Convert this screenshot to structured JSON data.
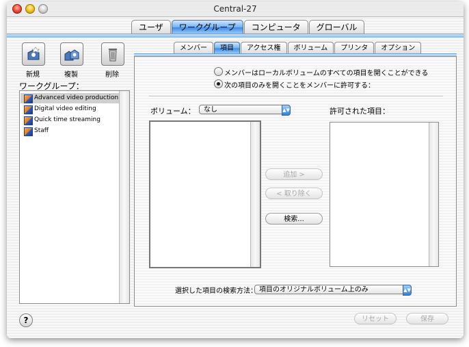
{
  "window": {
    "title": "Central-27"
  },
  "main_tabs": [
    {
      "label": "ユーザ",
      "active": false
    },
    {
      "label": "ワークグループ",
      "active": true
    },
    {
      "label": "コンピュータ",
      "active": false
    },
    {
      "label": "グローバル",
      "active": false
    }
  ],
  "toolbar": {
    "new_label": "新規",
    "duplicate_label": "複製",
    "delete_label": "削除"
  },
  "workgroups": {
    "label": "ワークグループ：",
    "items": [
      {
        "label": "Advanced video production",
        "selected": true
      },
      {
        "label": "Digital video editing",
        "selected": false
      },
      {
        "label": "Quick time streaming",
        "selected": false
      },
      {
        "label": "Staff",
        "selected": false
      }
    ]
  },
  "sub_tabs": [
    {
      "label": "メンバー",
      "active": false
    },
    {
      "label": "項目",
      "active": true
    },
    {
      "label": "アクセス権",
      "active": false
    },
    {
      "label": "ボリューム",
      "active": false
    },
    {
      "label": "プリンタ",
      "active": false
    },
    {
      "label": "オプション",
      "active": false
    }
  ],
  "options": {
    "radio_all": {
      "label": "メンバーはローカルボリュームのすべての項目を開くことができる",
      "checked": false
    },
    "radio_only": {
      "label": "次の項目のみを開くことをメンバーに許可する：",
      "checked": true
    }
  },
  "volume": {
    "label": "ボリューム：",
    "value": "なし"
  },
  "allowed_items": {
    "label": "許可された項目："
  },
  "buttons": {
    "add": "追加 >",
    "remove": "< 取り除く",
    "search": "検索..."
  },
  "search_method": {
    "label": "選択した項目の検索方法：",
    "value": "項目のオリジナルボリューム上のみ"
  },
  "footer": {
    "reset": "リセット",
    "save": "保存",
    "help": "?"
  }
}
